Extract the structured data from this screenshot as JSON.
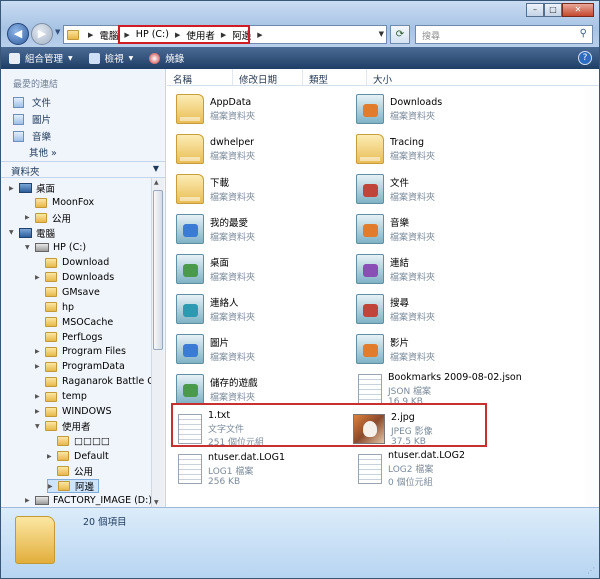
{
  "window": {
    "address": {
      "crumbs": [
        "電腦",
        "HP (C:)",
        "使用者",
        "阿邊"
      ],
      "separator": "▶"
    },
    "search_placeholder": "搜尋",
    "controls": {
      "minimize": "–",
      "maximize": "□",
      "close": "✕"
    }
  },
  "toolbar": {
    "organize": "組合管理",
    "views": "檢視",
    "burn": "燒錄"
  },
  "nav": {
    "favorites_title": "最愛的連結",
    "favorites": [
      "文件",
      "圖片",
      "音樂"
    ],
    "more": "其他 »",
    "folders_header": "資料夾",
    "tree": [
      {
        "label": "桌面",
        "type": "desktop"
      },
      {
        "label": "MoonFox",
        "type": "user"
      },
      {
        "label": "公用",
        "type": "folder"
      },
      {
        "label": "電腦",
        "type": "pc"
      },
      {
        "label": "HP (C:)",
        "type": "drive"
      },
      {
        "label": "Download",
        "type": "folder"
      },
      {
        "label": "Downloads",
        "type": "folder"
      },
      {
        "label": "GMsave",
        "type": "folder"
      },
      {
        "label": "hp",
        "type": "folder"
      },
      {
        "label": "MSOCache",
        "type": "folder"
      },
      {
        "label": "PerfLogs",
        "type": "folder"
      },
      {
        "label": "Program Files",
        "type": "folder"
      },
      {
        "label": "ProgramData",
        "type": "folder"
      },
      {
        "label": "Raganarok Battle Offli",
        "type": "folder"
      },
      {
        "label": "temp",
        "type": "folder"
      },
      {
        "label": "WINDOWS",
        "type": "folder"
      },
      {
        "label": "使用者",
        "type": "folder"
      },
      {
        "label": "□□□□",
        "type": "folder"
      },
      {
        "label": "Default",
        "type": "folder"
      },
      {
        "label": "公用",
        "type": "folder"
      },
      {
        "label": "阿邊",
        "type": "folder"
      },
      {
        "label": "FACTORY_IMAGE (D:)",
        "type": "drive"
      }
    ]
  },
  "columns": [
    "名稱",
    "修改日期",
    "類型",
    "大小"
  ],
  "items": [
    {
      "name": "AppData",
      "sub": "檔案資料夾",
      "kind": "folder"
    },
    {
      "name": "Downloads",
      "sub": "檔案資料夾",
      "kind": "sfolder"
    },
    {
      "name": "dwhelper",
      "sub": "檔案資料夾",
      "kind": "folder"
    },
    {
      "name": "Tracing",
      "sub": "檔案資料夾",
      "kind": "folder"
    },
    {
      "name": "下載",
      "sub": "檔案資料夾",
      "kind": "folder"
    },
    {
      "name": "文件",
      "sub": "檔案資料夾",
      "kind": "sfolder"
    },
    {
      "name": "我的最愛",
      "sub": "檔案資料夾",
      "kind": "sfolder"
    },
    {
      "name": "音樂",
      "sub": "檔案資料夾",
      "kind": "sfolder"
    },
    {
      "name": "桌面",
      "sub": "檔案資料夾",
      "kind": "sfolder"
    },
    {
      "name": "連結",
      "sub": "檔案資料夾",
      "kind": "sfolder"
    },
    {
      "name": "連絡人",
      "sub": "檔案資料夾",
      "kind": "sfolder"
    },
    {
      "name": "搜尋",
      "sub": "檔案資料夾",
      "kind": "sfolder"
    },
    {
      "name": "圖片",
      "sub": "檔案資料夾",
      "kind": "sfolder"
    },
    {
      "name": "影片",
      "sub": "檔案資料夾",
      "kind": "sfolder"
    },
    {
      "name": "儲存的遊戲",
      "sub": "檔案資料夾",
      "kind": "sfolder"
    },
    {
      "name": "Bookmarks 2009-08-02.json",
      "sub": "JSON 檔案",
      "sub2": "16.9 KB",
      "kind": "doc"
    },
    {
      "name": "1.txt",
      "sub": "文字文件",
      "sub2": "251 個位元組",
      "kind": "doc"
    },
    {
      "name": "2.jpg",
      "sub": "JPEG 影像",
      "sub2": "37.5 KB",
      "kind": "photo"
    },
    {
      "name": "ntuser.dat.LOG1",
      "sub": "LOG1 檔案",
      "sub2": "256 KB",
      "kind": "doc"
    },
    {
      "name": "ntuser.dat.LOG2",
      "sub": "LOG2 檔案",
      "sub2": "0 個位元組",
      "kind": "doc"
    }
  ],
  "details": {
    "count": "20 個項目"
  }
}
